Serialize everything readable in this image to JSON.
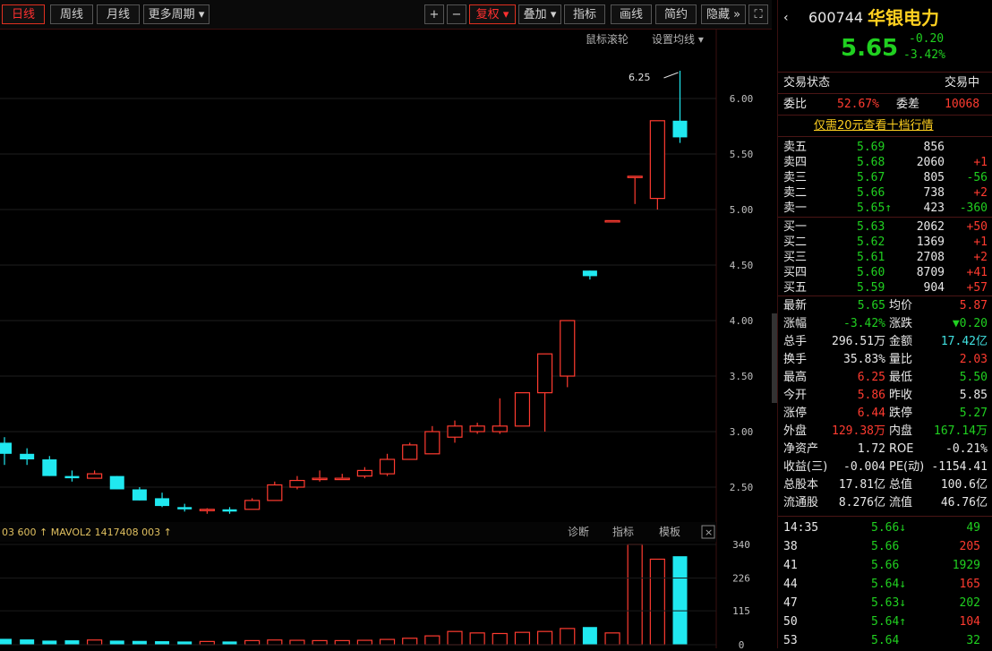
{
  "toolbar": {
    "periods": [
      "日线",
      "周线",
      "月线",
      "更多周期"
    ],
    "buttons": [
      "+",
      "−",
      "复权",
      "叠加",
      "指标",
      "画线",
      "简约",
      "隐藏"
    ],
    "right_links": [
      "鼠标滚轮",
      "设置均线"
    ]
  },
  "chart_data": {
    "type": "candlestick",
    "price_ticks": [
      "6.00",
      "5.50",
      "5.00",
      "4.50",
      "4.00",
      "3.50",
      "3.00",
      "2.50"
    ],
    "high_label": "6.25",
    "ohlc": [
      [
        2.9,
        2.95,
        2.7,
        2.8
      ],
      [
        2.8,
        2.85,
        2.7,
        2.75
      ],
      [
        2.75,
        2.78,
        2.6,
        2.6
      ],
      [
        2.6,
        2.65,
        2.55,
        2.58
      ],
      [
        2.58,
        2.65,
        2.58,
        2.62
      ],
      [
        2.6,
        2.6,
        2.48,
        2.48
      ],
      [
        2.48,
        2.5,
        2.38,
        2.38
      ],
      [
        2.4,
        2.45,
        2.32,
        2.33
      ],
      [
        2.32,
        2.35,
        2.28,
        2.3
      ],
      [
        2.3,
        2.31,
        2.26,
        2.3
      ],
      [
        2.3,
        2.32,
        2.26,
        2.28
      ],
      [
        2.3,
        2.4,
        2.3,
        2.38
      ],
      [
        2.38,
        2.55,
        2.38,
        2.52
      ],
      [
        2.5,
        2.6,
        2.48,
        2.56
      ],
      [
        2.58,
        2.65,
        2.55,
        2.58
      ],
      [
        2.58,
        2.62,
        2.58,
        2.58
      ],
      [
        2.6,
        2.68,
        2.58,
        2.65
      ],
      [
        2.62,
        2.8,
        2.6,
        2.75
      ],
      [
        2.75,
        2.9,
        2.75,
        2.88
      ],
      [
        2.8,
        3.05,
        2.8,
        3.0
      ],
      [
        2.95,
        3.1,
        2.9,
        3.05
      ],
      [
        3.0,
        3.08,
        2.98,
        3.05
      ],
      [
        3.0,
        3.3,
        2.98,
        3.05
      ],
      [
        3.05,
        3.35,
        3.05,
        3.35
      ],
      [
        3.35,
        3.7,
        3.0,
        3.7
      ],
      [
        3.5,
        4.0,
        3.4,
        4.0
      ],
      [
        4.45,
        4.45,
        4.37,
        4.4
      ],
      [
        4.9,
        4.9,
        4.9,
        4.9
      ],
      [
        5.3,
        5.3,
        5.05,
        5.3
      ],
      [
        5.1,
        5.8,
        5.0,
        5.8
      ],
      [
        5.8,
        6.25,
        5.6,
        5.65
      ]
    ],
    "volume_ticks": [
      "340",
      "226",
      "115",
      "0"
    ],
    "volumes": [
      20,
      18,
      14,
      15,
      16,
      14,
      13,
      12,
      11,
      11,
      11,
      14,
      16,
      15,
      14,
      14,
      15,
      18,
      22,
      30,
      45,
      40,
      38,
      42,
      45,
      55,
      60,
      40,
      340,
      290,
      300
    ]
  },
  "indicator_bar": {
    "text": "03 600 ↑ MAVOL2 1417408 003 ↑",
    "links": [
      "模板",
      "指标",
      "诊断",
      "诊断"
    ]
  },
  "panel": {
    "code": "600744",
    "name": "华银电力",
    "price": "5.65",
    "change": "-0.20",
    "pct": "-3.42%",
    "status_label": "交易状态",
    "status_value": "交易中",
    "wb_label": "委比",
    "wb_value": "52.67%",
    "wc_label": "委差",
    "wc_value": "10068",
    "promo": "仅需20元查看十档行情",
    "asks": [
      {
        "label": "卖五",
        "price": "5.69",
        "vol": "856",
        "chg": ""
      },
      {
        "label": "卖四",
        "price": "5.68",
        "vol": "2060",
        "chg": "+1"
      },
      {
        "label": "卖三",
        "price": "5.67",
        "vol": "805",
        "chg": "-56"
      },
      {
        "label": "卖二",
        "price": "5.66",
        "vol": "738",
        "chg": "+2"
      },
      {
        "label": "卖一",
        "price": "5.65↑",
        "vol": "423",
        "chg": "-360"
      }
    ],
    "bids": [
      {
        "label": "买一",
        "price": "5.63",
        "vol": "2062",
        "chg": "+50"
      },
      {
        "label": "买二",
        "price": "5.62",
        "vol": "1369",
        "chg": "+1"
      },
      {
        "label": "买三",
        "price": "5.61",
        "vol": "2708",
        "chg": "+2"
      },
      {
        "label": "买四",
        "price": "5.60",
        "vol": "8709",
        "chg": "+41"
      },
      {
        "label": "买五",
        "price": "5.59",
        "vol": "904",
        "chg": "+57"
      }
    ],
    "stats": [
      [
        "最新",
        "5.65",
        "均价",
        "5.87"
      ],
      [
        "涨幅",
        "-3.42%",
        "涨跌",
        "▼0.20"
      ],
      [
        "总手",
        "296.51万",
        "金额",
        "17.42亿"
      ],
      [
        "换手",
        "35.83%",
        "量比",
        "2.03"
      ],
      [
        "最高",
        "6.25",
        "最低",
        "5.50"
      ],
      [
        "今开",
        "5.86",
        "昨收",
        "5.85"
      ],
      [
        "涨停",
        "6.44",
        "跌停",
        "5.27"
      ],
      [
        "外盘",
        "129.38万",
        "内盘",
        "167.14万"
      ],
      [
        "净资产",
        "1.72",
        "ROE",
        "-0.21%"
      ],
      [
        "收益(三)",
        "-0.004",
        "PE(动)",
        "-1154.41"
      ],
      [
        "总股本",
        "17.81亿",
        "总值",
        "100.6亿"
      ],
      [
        "流通股",
        "8.276亿",
        "流值",
        "46.76亿"
      ]
    ],
    "ticks": [
      [
        "14:35",
        "5.66↓",
        "49"
      ],
      [
        "38",
        "5.66",
        "205"
      ],
      [
        "41",
        "5.66",
        "1929"
      ],
      [
        "44",
        "5.64↓",
        "165"
      ],
      [
        "47",
        "5.63↓",
        "202"
      ],
      [
        "50",
        "5.64↑",
        "104"
      ],
      [
        "53",
        "5.64",
        "32"
      ]
    ]
  }
}
